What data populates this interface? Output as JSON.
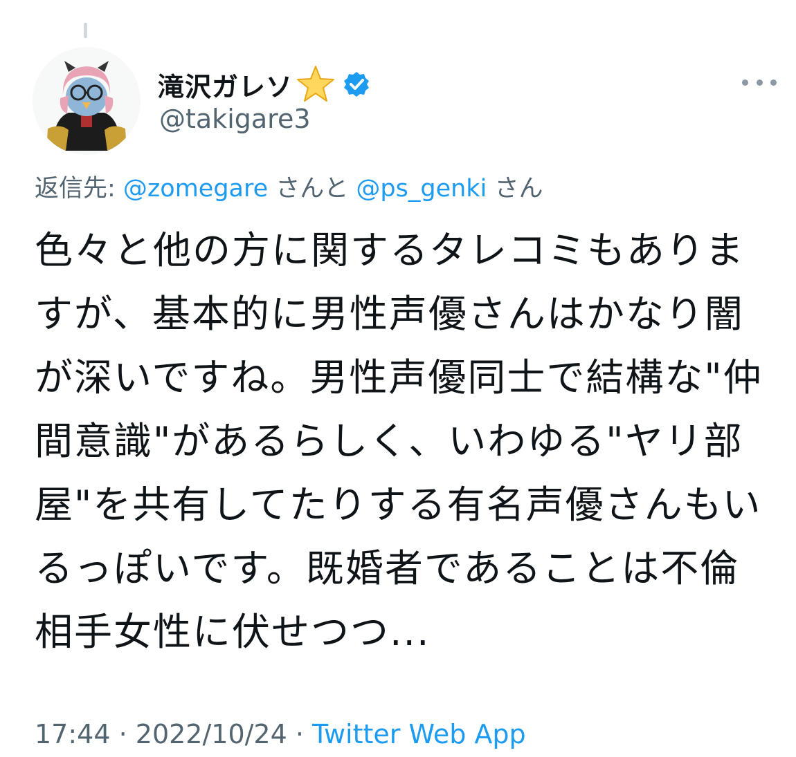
{
  "tweet": {
    "author": {
      "display_name": "滝沢ガレソ",
      "name_badge_icon": "star-icon",
      "verified_icon": "verified-badge-icon",
      "handle": "@takigare3",
      "avatar": "avatar-image"
    },
    "more_icon": "more-options-icon",
    "reply_to": {
      "prefix": "返信先: ",
      "mention_1": "@zomegare",
      "joiner": " さんと ",
      "mention_2": "@ps_genki",
      "suffix": " さん"
    },
    "text": "色々と他の方に関するタレコミもありますが、基本的に男性声優さんはかなり闇が深いですね。男性声優同士で結構な\"仲間意識\"があるらしく、いわゆる\"ヤリ部屋\"を共有してたりする有名声優さんもいるっぽいです。既婚者であることは不倫相手女性に伏せつつ...",
    "time": "17:44",
    "sep1": " · ",
    "date": "2022/10/24",
    "sep2": " · ",
    "source": "Twitter Web App"
  },
  "colors": {
    "text": "#0f1419",
    "secondary": "#536471",
    "link": "#1d9bf0",
    "thread_line": "#cfd9de"
  }
}
